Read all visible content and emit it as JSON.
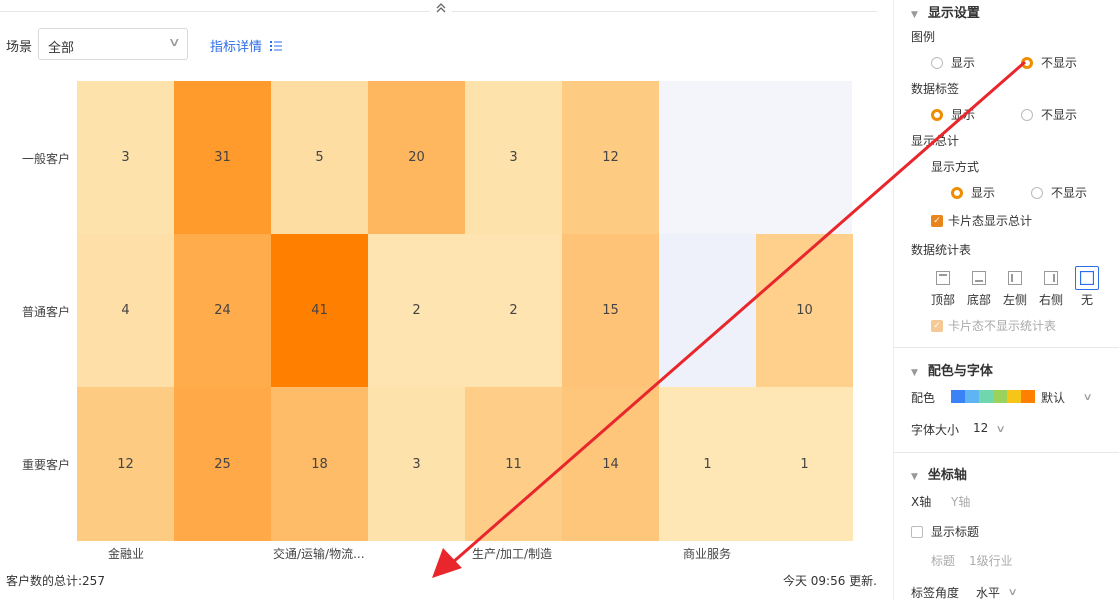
{
  "toolbar": {
    "scene_label": "场景",
    "scene_value": "全部",
    "index_link": "指标详情"
  },
  "heatmap": {
    "rows": [
      "一般客户",
      "普通客户",
      "重要客户"
    ],
    "columns": [
      "金融业",
      "交通/运输/物流...",
      "生产/加工/制造",
      "商业服务"
    ],
    "values": [
      [
        3,
        31,
        5,
        20,
        3,
        12,
        null,
        null
      ],
      [
        4,
        24,
        41,
        2,
        2,
        15,
        null,
        10
      ],
      [
        12,
        25,
        18,
        3,
        11,
        14,
        1,
        1
      ]
    ],
    "colors": {
      "low": "#fee7b5",
      "high": "#ff8000",
      "empty_row1": "#f4f5fa",
      "empty_row2": "#eef1f9"
    }
  },
  "footer": {
    "total": "客户数的总计:257",
    "updated": "今天 09:56 更新."
  },
  "panel": {
    "display": {
      "title": "显示设置",
      "legend_label": "图例",
      "legend_show": "显示",
      "legend_hide": "不显示",
      "data_label_label": "数据标签",
      "data_label_show": "显示",
      "data_label_hide": "不显示",
      "total_label": "显示总计",
      "mode_label": "显示方式",
      "mode_show": "显示",
      "mode_hide": "不显示",
      "card_total": "卡片态显示总计",
      "stat_table_label": "数据统计表",
      "positions": [
        "顶部",
        "底部",
        "左侧",
        "右侧",
        "无"
      ],
      "card_no_stat": "卡片态不显示统计表"
    },
    "color_font": {
      "title": "配色与字体",
      "color_label": "配色",
      "color_value": "默认",
      "palette": [
        "#3b82f6",
        "#5fb4f4",
        "#6fd6b0",
        "#9bd25b",
        "#f5c518",
        "#ff8000"
      ],
      "font_size_label": "字体大小",
      "font_size_value": "12"
    },
    "axis": {
      "title": "坐标轴",
      "x_tab": "X轴",
      "y_tab": "Y轴",
      "show_title": "显示标题",
      "title_label": "标题",
      "title_value": "1级行业",
      "angle_label": "标签角度",
      "angle_value": "水平"
    }
  }
}
